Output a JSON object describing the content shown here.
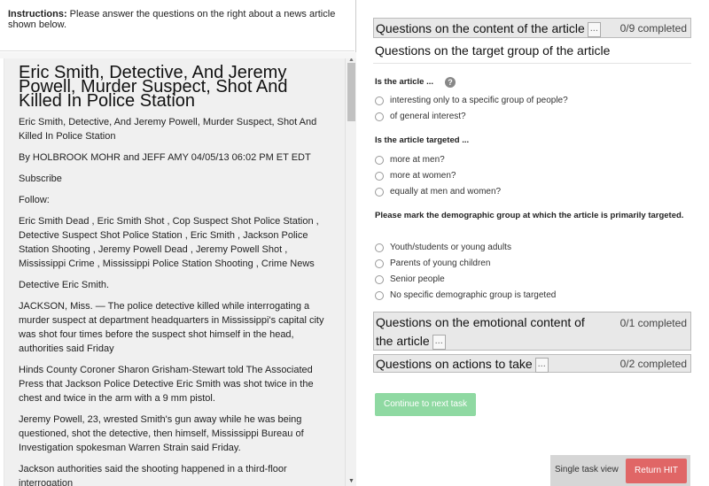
{
  "instructions": {
    "label": "Instructions:",
    "text": " Please answer the questions on the right about a news article shown below."
  },
  "article": {
    "headline": "Eric Smith, Detective, And Jeremy Powell, Murder Suspect, Shot And Killed In Police Station",
    "subtitle": "Eric Smith, Detective, And Jeremy Powell, Murder Suspect, Shot And Killed In Police Station",
    "byline": "By HOLBROOK MOHR and JEFF AMY 04/05/13 06:02 PM ET EDT",
    "subscribe": "Subscribe",
    "follow": "Follow:",
    "tags": "Eric Smith Dead , Eric Smith Shot , Cop Suspect Shot Police Station , Detective Suspect Shot Police Station , Eric Smith , Jackson Police Station Shooting , Jeremy Powell Dead , Jeremy Powell Shot , Mississippi Crime , Mississippi Police Station Shooting , Crime News",
    "caption": "Detective Eric Smith.",
    "paragraphs": [
      "JACKSON, Miss. — The police detective killed while interrogating a murder suspect at department headquarters in Mississippi's capital city was shot four times before the suspect shot himself in the head, authorities said Friday",
      "Hinds County Coroner Sharon Grisham-Stewart told The Associated Press that Jackson Police Detective Eric Smith was shot twice in the chest and twice in the arm with a 9 mm pistol.",
      "Jeremy Powell, 23, wrested Smith's gun away while he was being questioned, shot the detective, then himself, Mississippi Bureau of Investigation spokesman Warren Strain said Friday.",
      "Jackson authorities said the shooting happened in a third-floor interrogation"
    ]
  },
  "sections": {
    "content": {
      "title": "Questions on the content of the article",
      "dots": "...",
      "progress": "0/9 completed"
    },
    "target": {
      "title": "Questions on the target group of the article"
    },
    "emotional": {
      "title_line1": "Questions on the emotional content of",
      "title_line2": "the article",
      "dots": "...",
      "progress": "0/1 completed"
    },
    "actions": {
      "title": "Questions on actions to take",
      "dots": "...",
      "progress": "0/2 completed"
    }
  },
  "questions": {
    "q1": {
      "label": "Is the article ...",
      "help": "?",
      "options": [
        "interesting only to a specific group of people?",
        "of general interest?"
      ]
    },
    "q2": {
      "label": "Is the article targeted ...",
      "options": [
        "more at men?",
        "more at women?",
        "equally at men and women?"
      ]
    },
    "q3": {
      "label": "Please mark the demographic group at which the article is primarily targeted.",
      "options": [
        "Youth/students or young adults",
        "Parents of young children",
        "Senior people",
        "No specific demographic group is targeted"
      ]
    }
  },
  "buttons": {
    "continue": "Continue to next task",
    "single_task": "Single task view",
    "return_hit": "Return HIT"
  },
  "colors": {
    "continue_bg": "#8fd9a2",
    "return_bg": "#e06666"
  }
}
